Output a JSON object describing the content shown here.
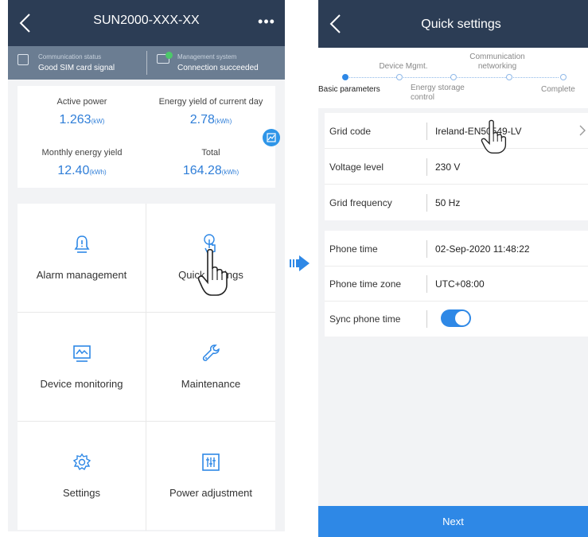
{
  "left_screen": {
    "title": "SUN2000-XXX-XX",
    "more_icon": "more-dots-icon",
    "status": {
      "communication_caption": "Communication status",
      "communication_value": "Good SIM card signal",
      "management_caption": "Management system",
      "management_value": "Connection succeeded"
    },
    "energy": {
      "active_power_label": "Active power",
      "active_power_value": "1.263",
      "active_power_unit": "(kW)",
      "daily_yield_label": "Energy yield of current day",
      "daily_yield_value": "2.78",
      "daily_yield_unit": "(kWh)",
      "monthly_yield_label": "Monthly energy yield",
      "monthly_yield_value": "12.40",
      "monthly_yield_unit": "(kWh)",
      "total_label": "Total",
      "total_value": "164.28",
      "total_unit": "(kWh)"
    },
    "tiles": [
      {
        "label": "Alarm management",
        "icon": "bell-icon"
      },
      {
        "label": "Quick settings",
        "icon": "touch-icon"
      },
      {
        "label": "Device monitoring",
        "icon": "monitor-icon"
      },
      {
        "label": "Maintenance",
        "icon": "wrench-icon"
      },
      {
        "label": "Settings",
        "icon": "gear-icon"
      },
      {
        "label": "Power adjustment",
        "icon": "sliders-icon"
      }
    ]
  },
  "right_screen": {
    "title": "Quick settings",
    "steps": [
      {
        "label": "Basic parameters",
        "active": true
      },
      {
        "label": "Device Mgmt.",
        "active": false
      },
      {
        "label": "Energy storage control",
        "active": false
      },
      {
        "label": "Communication networking",
        "active": false
      },
      {
        "label": "Complete",
        "active": false
      }
    ],
    "grid_settings": [
      {
        "label": "Grid code",
        "value": "Ireland-EN50549-LV"
      },
      {
        "label": "Voltage level",
        "value": "230 V"
      },
      {
        "label": "Grid frequency",
        "value": "50 Hz"
      }
    ],
    "time_settings": {
      "phone_time_label": "Phone time",
      "phone_time_value": "02-Sep-2020 11:48:22",
      "time_zone_label": "Phone time zone",
      "time_zone_value": "UTC+08:00",
      "sync_label": "Sync phone time",
      "sync_enabled": true
    },
    "next_label": "Next"
  },
  "colors": {
    "header_bg": "#2c3d55",
    "status_bg": "#6b7d92",
    "accent": "#2e88e6",
    "value_blue": "#2f7ed8",
    "arrow": "#2e88e6"
  }
}
